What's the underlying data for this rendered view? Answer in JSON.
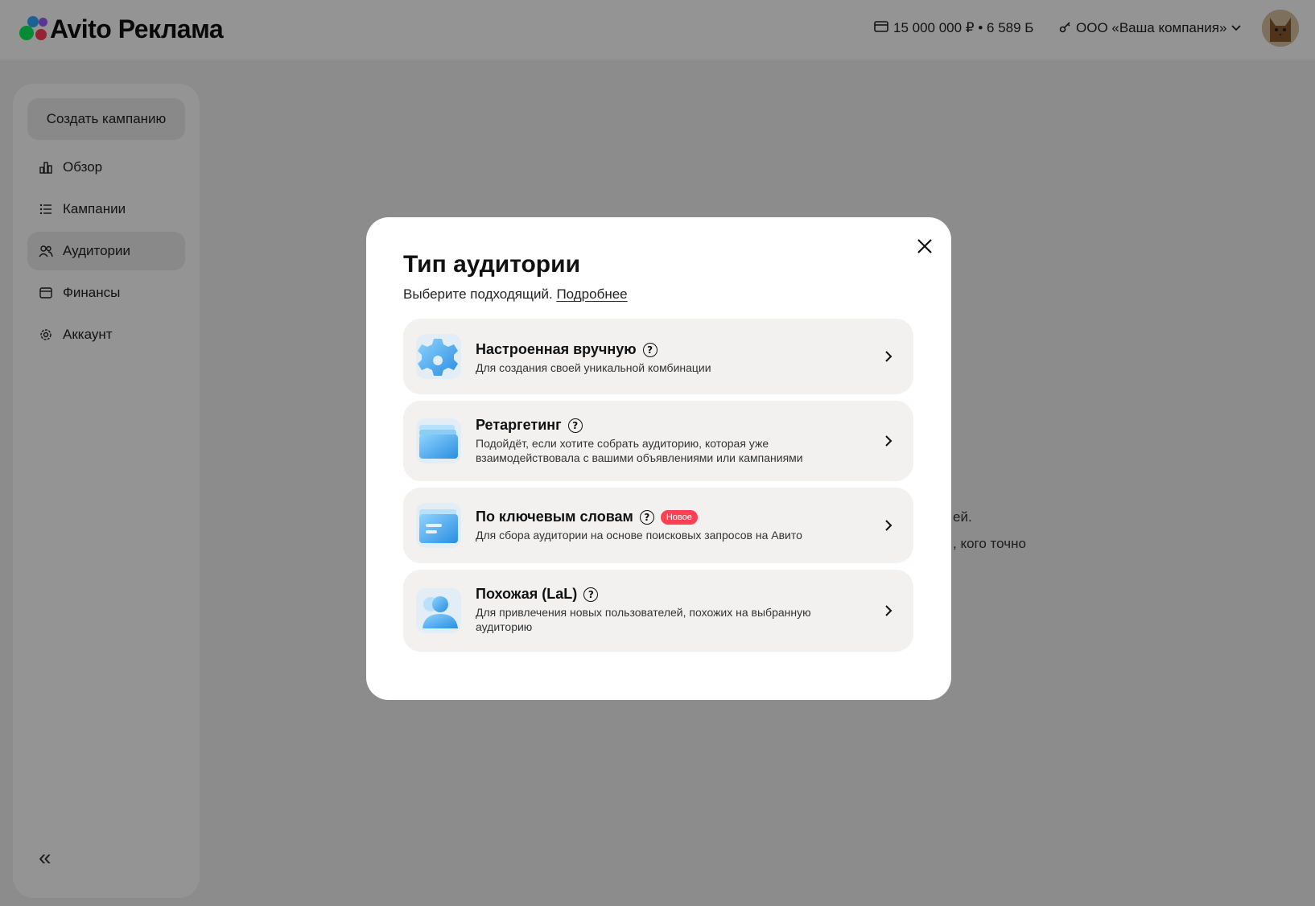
{
  "header": {
    "logo_text": "Avito Реклама",
    "balance": "15 000 000 ₽ • 6 589 Б",
    "company": "ООО «Ваша компания»"
  },
  "sidebar": {
    "create_label": "Создать кампанию",
    "items": [
      {
        "label": "Обзор",
        "icon": "chart-icon"
      },
      {
        "label": "Кампании",
        "icon": "list-icon"
      },
      {
        "label": "Аудитории",
        "icon": "users-icon",
        "active": true
      },
      {
        "label": "Финансы",
        "icon": "wallet-icon"
      },
      {
        "label": "Аккаунт",
        "icon": "gear-icon"
      }
    ],
    "collapse_label": "«"
  },
  "background": {
    "fragment_1": "ей.",
    "fragment_2": ", кого  точно"
  },
  "modal": {
    "title": "Тип аудитории",
    "subtitle": "Выберите подходящий.",
    "more_link": "Подробнее",
    "options": [
      {
        "title": "Настроенная вручную",
        "desc": "Для создания своей уникальной комбинации",
        "icon": "gear-cog-icon"
      },
      {
        "title": "Ретаргетинг",
        "desc": "Подойдёт, если хотите собрать аудиторию, которая уже взаимодействовала с вашими объявлениями или кампаниями",
        "icon": "stack-icon"
      },
      {
        "title": "По ключевым словам",
        "desc": "Для сбора аудитории на основе поисковых запросов на Авито",
        "badge": "Новое",
        "icon": "card-icon"
      },
      {
        "title": "Похожая (LaL)",
        "desc": "Для привлечения новых пользователей, похожих на выбранную аудиторию",
        "icon": "people-icon"
      }
    ]
  },
  "colors": {
    "accent_badge": "#ff4053",
    "overlay": "rgba(0,0,0,0.42)",
    "icon_blue": "#3aa8e8"
  }
}
